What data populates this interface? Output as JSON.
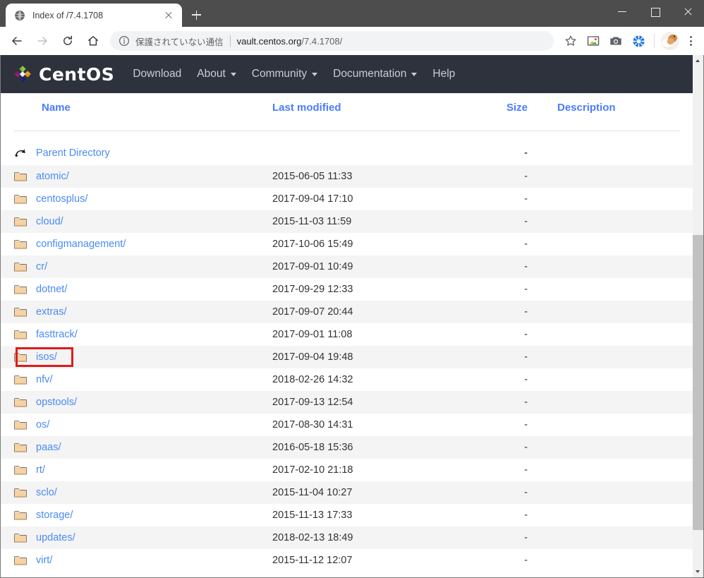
{
  "browser": {
    "tab": {
      "title": "Index of /7.4.1708",
      "favicon": "globe-icon",
      "close": "×"
    },
    "new_tab_label": "+",
    "window_controls": {
      "minimize": "minimize-icon",
      "maximize": "maximize-icon",
      "close": "close-icon"
    },
    "toolbar": {
      "back": "back-arrow-icon",
      "forward": "forward-arrow-icon",
      "reload": "reload-icon",
      "home": "home-icon",
      "bookmark": "star-icon",
      "extension": "extension-icon",
      "screenshot": "camera-icon",
      "sync": "sync-icon",
      "avatar": "profile-avatar",
      "menu": "three-dot-menu-icon"
    },
    "omnibox": {
      "info_icon": "info-circle-icon",
      "security_text": "保護されていない通信",
      "separator": "|",
      "url_host": "vault.centos.org",
      "url_path": "/7.4.1708/"
    }
  },
  "site": {
    "brand": "CentOS",
    "logo": "centos-logo-icon",
    "nav": [
      {
        "label": "Download",
        "has_dropdown": false
      },
      {
        "label": "About",
        "has_dropdown": true
      },
      {
        "label": "Community",
        "has_dropdown": true
      },
      {
        "label": "Documentation",
        "has_dropdown": true
      },
      {
        "label": "Help",
        "has_dropdown": false
      }
    ]
  },
  "listing": {
    "headers": {
      "name": "Name",
      "last_modified": "Last modified",
      "size": "Size",
      "description": "Description"
    },
    "parent": {
      "label": "Parent Directory",
      "size": "-",
      "icon": "back-directory-icon"
    },
    "rows": [
      {
        "name": "atomic/",
        "modified": "2015-06-05 11:33",
        "size": "-",
        "description": ""
      },
      {
        "name": "centosplus/",
        "modified": "2017-09-04 17:10",
        "size": "-",
        "description": ""
      },
      {
        "name": "cloud/",
        "modified": "2015-11-03 11:59",
        "size": "-",
        "description": ""
      },
      {
        "name": "configmanagement/",
        "modified": "2017-10-06 15:49",
        "size": "-",
        "description": ""
      },
      {
        "name": "cr/",
        "modified": "2017-09-01 10:49",
        "size": "-",
        "description": ""
      },
      {
        "name": "dotnet/",
        "modified": "2017-09-29 12:33",
        "size": "-",
        "description": ""
      },
      {
        "name": "extras/",
        "modified": "2017-09-07 20:44",
        "size": "-",
        "description": ""
      },
      {
        "name": "fasttrack/",
        "modified": "2017-09-01 11:08",
        "size": "-",
        "description": ""
      },
      {
        "name": "isos/",
        "modified": "2017-09-04 19:48",
        "size": "-",
        "description": "",
        "highlighted": true
      },
      {
        "name": "nfv/",
        "modified": "2018-02-26 14:32",
        "size": "-",
        "description": ""
      },
      {
        "name": "opstools/",
        "modified": "2017-09-13 12:54",
        "size": "-",
        "description": ""
      },
      {
        "name": "os/",
        "modified": "2017-08-30 14:31",
        "size": "-",
        "description": ""
      },
      {
        "name": "paas/",
        "modified": "2016-05-18 15:36",
        "size": "-",
        "description": ""
      },
      {
        "name": "rt/",
        "modified": "2017-02-10 21:18",
        "size": "-",
        "description": ""
      },
      {
        "name": "sclo/",
        "modified": "2015-11-04 10:27",
        "size": "-",
        "description": ""
      },
      {
        "name": "storage/",
        "modified": "2015-11-13 17:33",
        "size": "-",
        "description": ""
      },
      {
        "name": "updates/",
        "modified": "2018-02-13 18:49",
        "size": "-",
        "description": ""
      },
      {
        "name": "virt/",
        "modified": "2015-11-12 12:07",
        "size": "-",
        "description": ""
      }
    ]
  },
  "colors": {
    "link": "#4a8bf5",
    "header_link": "#4a7dfa",
    "annotation": "#e01b1b",
    "centos_bar": "#2d323c",
    "row_alt": "#f4f4f4"
  }
}
